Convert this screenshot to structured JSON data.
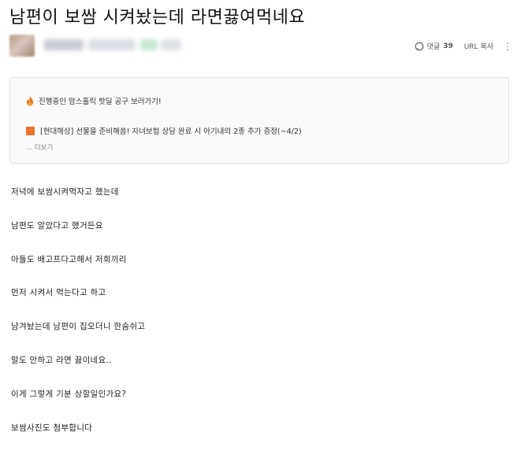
{
  "post": {
    "title": "남편이 보쌈 시켜놨는데 라면끓여먹네요"
  },
  "meta": {
    "comment_label": "댓글",
    "comment_count": "39",
    "url_copy_label": "URL 복사",
    "more_icon": "kebab-menu-icon"
  },
  "notice": {
    "line1_icon": "fire-icon",
    "line1_text": "진행중인 맘스홀릭 핫딜 공구 보러가기!",
    "line2_icon": "orange-square-icon",
    "line2_text": "[현대해상] 선물을 준비해쏨! 자녀보험 상담 완료 시 아기내의 2종 추가 증정(~4/2)",
    "more_text": "... 더보기"
  },
  "body": {
    "lines": [
      "저녁에 보쌈시켜먹자고 했는데",
      "남편도 알았다고 했거든요",
      "아들도 배고프다고해서 저희끼리",
      "먼저 시켜서 먹는다고 하고",
      "남겨놨는데 남편이 집오더니 한숨쉬고",
      "말도 안하고 라면 끓이네요..",
      "이게 그렇게 기분 상할일인가요?",
      "보쌈사진도 첨부합니다"
    ]
  },
  "colors": {
    "notice_square": "#e8742a",
    "fire": "#e07a1f"
  }
}
